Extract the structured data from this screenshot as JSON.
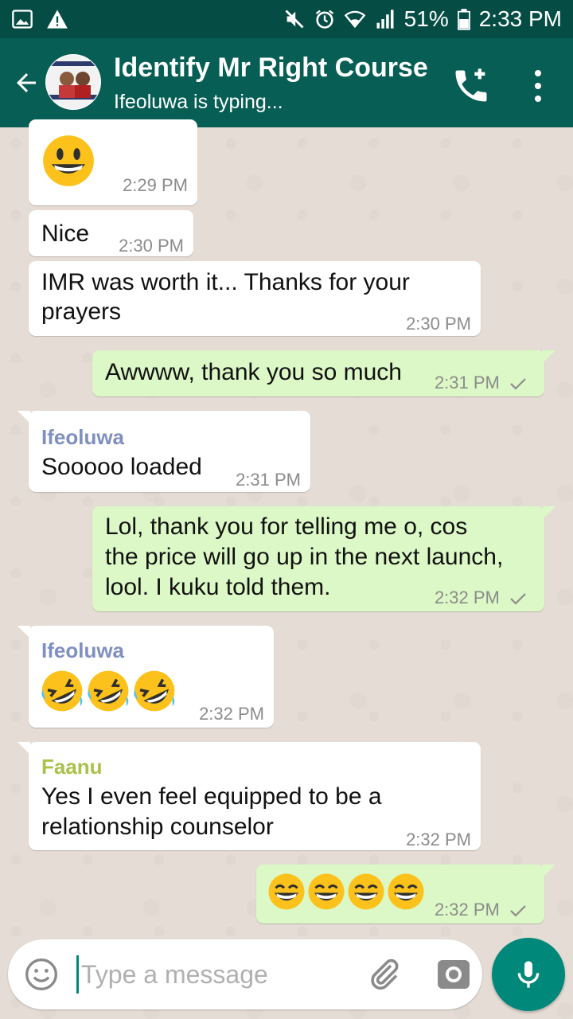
{
  "status_bar": {
    "battery": "51%",
    "time": "2:33 PM"
  },
  "header": {
    "title": "Identify Mr Right Course",
    "subtitle": "Ifeoluwa is typing..."
  },
  "messages": [
    {
      "direction": "in",
      "type": "emoji",
      "emoji": [
        "grinning-face"
      ],
      "time": "2:29 PM"
    },
    {
      "direction": "in",
      "text": "Nice",
      "time": "2:30 PM"
    },
    {
      "direction": "in",
      "text_lines": [
        "IMR was worth it... Thanks for your",
        "prayers"
      ],
      "time": "2:30 PM"
    },
    {
      "direction": "out",
      "text": "Awwww, thank you so much",
      "time": "2:31 PM",
      "status": "sent"
    },
    {
      "direction": "in",
      "sender": "Ifeoluwa",
      "text": "Sooooo loaded",
      "time": "2:31 PM"
    },
    {
      "direction": "out",
      "text_lines": [
        "Lol, thank you for telling me o, cos",
        "the price will go up in the next launch,",
        "lool. I kuku told them."
      ],
      "time": "2:32 PM",
      "status": "sent"
    },
    {
      "direction": "in",
      "sender": "Ifeoluwa",
      "type": "emoji",
      "emoji": [
        "rolling-on-floor-laughing",
        "rolling-on-floor-laughing",
        "rolling-on-floor-laughing"
      ],
      "time": "2:32 PM"
    },
    {
      "direction": "in",
      "sender": "Faanu",
      "text_lines": [
        "Yes I even feel equipped to be a",
        "relationship counselor"
      ],
      "time": "2:32 PM"
    },
    {
      "direction": "out",
      "type": "emoji",
      "emoji": [
        "grinning-smiling-eyes",
        "grinning-smiling-eyes",
        "grinning-smiling-eyes",
        "grinning-smiling-eyes"
      ],
      "time": "2:32 PM",
      "status": "sent"
    }
  ],
  "colors": {
    "header": "#075e54",
    "status_bar": "#054d44",
    "outgoing_bubble": "#dcf8c6",
    "incoming_bubble": "#ffffff",
    "sender_ifeoluwa": "#7f8fc0",
    "sender_faanu": "#a9c24a",
    "accent": "#00897b"
  },
  "composer": {
    "placeholder": "Type a message"
  }
}
